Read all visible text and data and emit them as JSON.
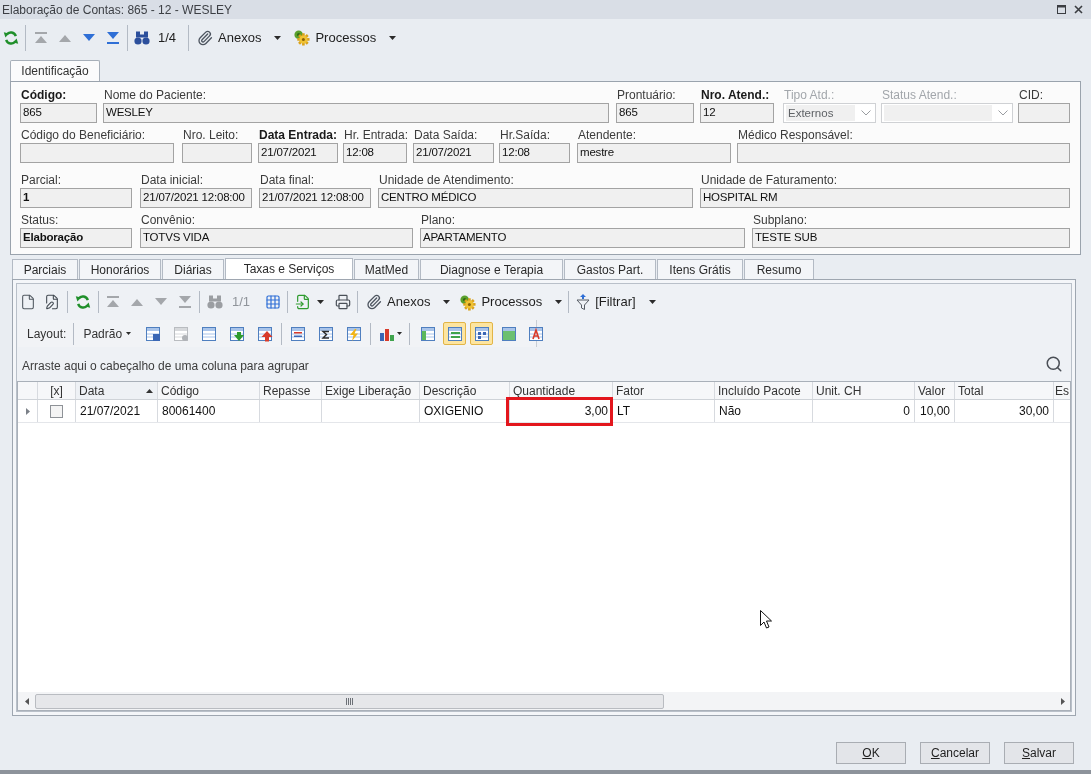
{
  "window": {
    "title": "Elaboração de Contas: 865 - 12 - WESLEY"
  },
  "toolbar": {
    "nav": [
      {
        "disabled": true
      },
      {
        "disabled": true
      },
      {
        "disabled": false
      },
      {
        "disabled": false
      }
    ],
    "record_counter": {
      "text": "1/4",
      "disabled": false
    },
    "menus": [
      {
        "kind": "attachments",
        "label": "Anexos"
      },
      {
        "kind": "processes",
        "label": "Processos"
      }
    ]
  },
  "main_tabs": [
    {
      "label": "Identificação",
      "selected": true
    }
  ],
  "form": {
    "rows": [
      {
        "fields": [
          {
            "label": "Código:",
            "value": "865",
            "kind": "text",
            "label_bold": true,
            "value_bold": false,
            "disabled": false
          },
          {
            "label": "Nome do Paciente:",
            "value": "WESLEY",
            "kind": "text",
            "label_bold": false,
            "value_bold": false,
            "disabled": false
          },
          {
            "label": "Prontuário:",
            "value": "865",
            "kind": "text",
            "label_bold": false,
            "value_bold": false,
            "disabled": false
          },
          {
            "label": "Nro. Atend.:",
            "value": "12",
            "kind": "text",
            "label_bold": true,
            "value_bold": false,
            "disabled": false
          },
          {
            "label": "Tipo Atd.:",
            "value": "Externos",
            "kind": "dropdown",
            "label_bold": false,
            "disabled": true
          },
          {
            "label": "Status Atend.:",
            "kind": "dropdown",
            "label_bold": false,
            "disabled": true
          },
          {
            "label": "CID:",
            "kind": "text",
            "label_bold": false,
            "disabled": false
          }
        ]
      },
      {
        "fields": [
          {
            "label": "Código do Beneficiário:",
            "kind": "text",
            "label_bold": false,
            "disabled": false
          },
          {
            "label": "Nro. Leito:",
            "kind": "text",
            "label_bold": false,
            "disabled": false
          },
          {
            "label": "Data Entrada:",
            "value": "21/07/2021",
            "kind": "text",
            "label_bold": true,
            "value_bold": false,
            "disabled": false
          },
          {
            "label": "Hr. Entrada:",
            "value": "12:08",
            "kind": "text",
            "label_bold": false,
            "value_bold": false,
            "disabled": false
          },
          {
            "label": "Data Saída:",
            "value": "21/07/2021",
            "kind": "text",
            "label_bold": false,
            "value_bold": false,
            "disabled": false
          },
          {
            "label": "Hr.Saída:",
            "value": "12:08",
            "kind": "text",
            "label_bold": false,
            "value_bold": false,
            "disabled": false
          },
          {
            "label": "Atendente:",
            "value": "mestre",
            "kind": "text",
            "label_bold": false,
            "value_bold": false,
            "disabled": false
          },
          {
            "label": "Médico Responsável:",
            "kind": "text",
            "label_bold": false,
            "disabled": false
          }
        ]
      },
      {
        "fields": [
          {
            "label": "Parcial:",
            "value": "1",
            "kind": "text",
            "label_bold": false,
            "value_bold": true,
            "disabled": false
          },
          {
            "label": "Data inicial:",
            "value": "21/07/2021 12:08:00",
            "kind": "text",
            "label_bold": false,
            "value_bold": false,
            "disabled": false
          },
          {
            "label": "Data final:",
            "value": "21/07/2021 12:08:00",
            "kind": "text",
            "label_bold": false,
            "value_bold": false,
            "disabled": false
          },
          {
            "label": "Unidade de Atendimento:",
            "value": "CENTRO MÉDICO",
            "kind": "text",
            "label_bold": false,
            "value_bold": false,
            "disabled": false
          },
          {
            "label": "Unidade de Faturamento:",
            "value": "HOSPITAL RM",
            "kind": "text",
            "label_bold": false,
            "value_bold": false,
            "disabled": false
          }
        ]
      },
      {
        "fields": [
          {
            "label": "Status:",
            "value": "Elaboração",
            "kind": "text",
            "label_bold": false,
            "value_bold": true,
            "disabled": false
          },
          {
            "label": "Convênio:",
            "value": "TOTVS VIDA",
            "kind": "text",
            "label_bold": false,
            "value_bold": false,
            "disabled": false
          },
          {
            "label": "Plano:",
            "value": "APARTAMENTO",
            "kind": "text",
            "label_bold": false,
            "value_bold": false,
            "disabled": false
          },
          {
            "label": "Subplano:",
            "value": "TESTE SUB",
            "kind": "text",
            "label_bold": false,
            "value_bold": false,
            "disabled": false
          }
        ]
      }
    ]
  },
  "detail_tabs": [
    {
      "label": "Parciais",
      "selected": false
    },
    {
      "label": "Honorários",
      "selected": false
    },
    {
      "label": "Diárias",
      "selected": false
    },
    {
      "label": "Taxas e Serviços",
      "selected": true
    },
    {
      "label": "MatMed",
      "selected": false
    },
    {
      "label": "Diagnose e Terapia",
      "selected": false
    },
    {
      "label": "Gastos Part.",
      "selected": false
    },
    {
      "label": "Itens Grátis",
      "selected": false
    },
    {
      "label": "Resumo",
      "selected": false
    }
  ],
  "grid_toolbar": {
    "nav": [
      {
        "disabled": true
      },
      {
        "disabled": true
      },
      {
        "disabled": true
      },
      {
        "disabled": true
      }
    ],
    "record_counter": {
      "text": "1/1",
      "disabled": true
    },
    "menus": [
      {
        "kind": "attachments",
        "label": "Anexos"
      },
      {
        "kind": "processes",
        "label": "Processos"
      },
      {
        "kind": "filter",
        "label": "[Filtrar]"
      }
    ]
  },
  "layout_bar": {
    "label": "Layout:",
    "preset": "Padrão",
    "actions": [
      {
        "disabled": false
      },
      {
        "disabled": true
      },
      {
        "disabled": false
      },
      {
        "disabled": false
      },
      {
        "disabled": false
      }
    ],
    "view_toggles": [
      {
        "selected": false
      },
      {
        "selected": true
      },
      {
        "selected": true
      },
      {
        "selected": false
      },
      {
        "selected": false
      }
    ]
  },
  "group_panel": {
    "hint": "Arraste aqui o cabeçalho de uma coluna para agrupar"
  },
  "table": {
    "columns": [
      {
        "label": "[x]",
        "sorted_ascending": false
      },
      {
        "label": "Data",
        "sorted_ascending": true
      },
      {
        "label": "Código",
        "sorted_ascending": false
      },
      {
        "label": "Repasse",
        "sorted_ascending": false
      },
      {
        "label": "Exige Liberação",
        "sorted_ascending": false
      },
      {
        "label": "Descrição",
        "sorted_ascending": false
      },
      {
        "label": "Quantidade",
        "sorted_ascending": false
      },
      {
        "label": "Fator",
        "sorted_ascending": false
      },
      {
        "label": "Incluído Pacote",
        "sorted_ascending": false
      },
      {
        "label": "Unit. CH",
        "sorted_ascending": false
      },
      {
        "label": "Valor",
        "sorted_ascending": false
      },
      {
        "label": "Total",
        "sorted_ascending": false
      },
      {
        "label": "Es",
        "sorted_ascending": false
      }
    ],
    "rows": [
      {
        "focused": true,
        "cells": [
          {
            "kind": "checkbox",
            "checked": false
          },
          {
            "kind": "text",
            "text": "21/07/2021",
            "highlighted": false
          },
          {
            "kind": "text",
            "text": "80061400",
            "highlighted": false
          },
          {
            "kind": "text",
            "text": "",
            "highlighted": false
          },
          {
            "kind": "text",
            "text": "",
            "highlighted": false
          },
          {
            "kind": "text",
            "text": "OXIGENIO",
            "highlighted": false
          },
          {
            "kind": "text",
            "text": "3,00",
            "highlighted": true
          },
          {
            "kind": "text",
            "text": "LT",
            "highlighted": false
          },
          {
            "kind": "text",
            "text": "Não",
            "highlighted": false
          },
          {
            "kind": "text",
            "text": "0",
            "highlighted": false
          },
          {
            "kind": "text",
            "text": "10,00",
            "highlighted": false
          },
          {
            "kind": "text",
            "text": "30,00",
            "highlighted": false
          }
        ]
      }
    ]
  },
  "buttons": [
    {
      "label": "OK"
    },
    {
      "label": "Cancelar"
    },
    {
      "label": "Salvar"
    }
  ]
}
